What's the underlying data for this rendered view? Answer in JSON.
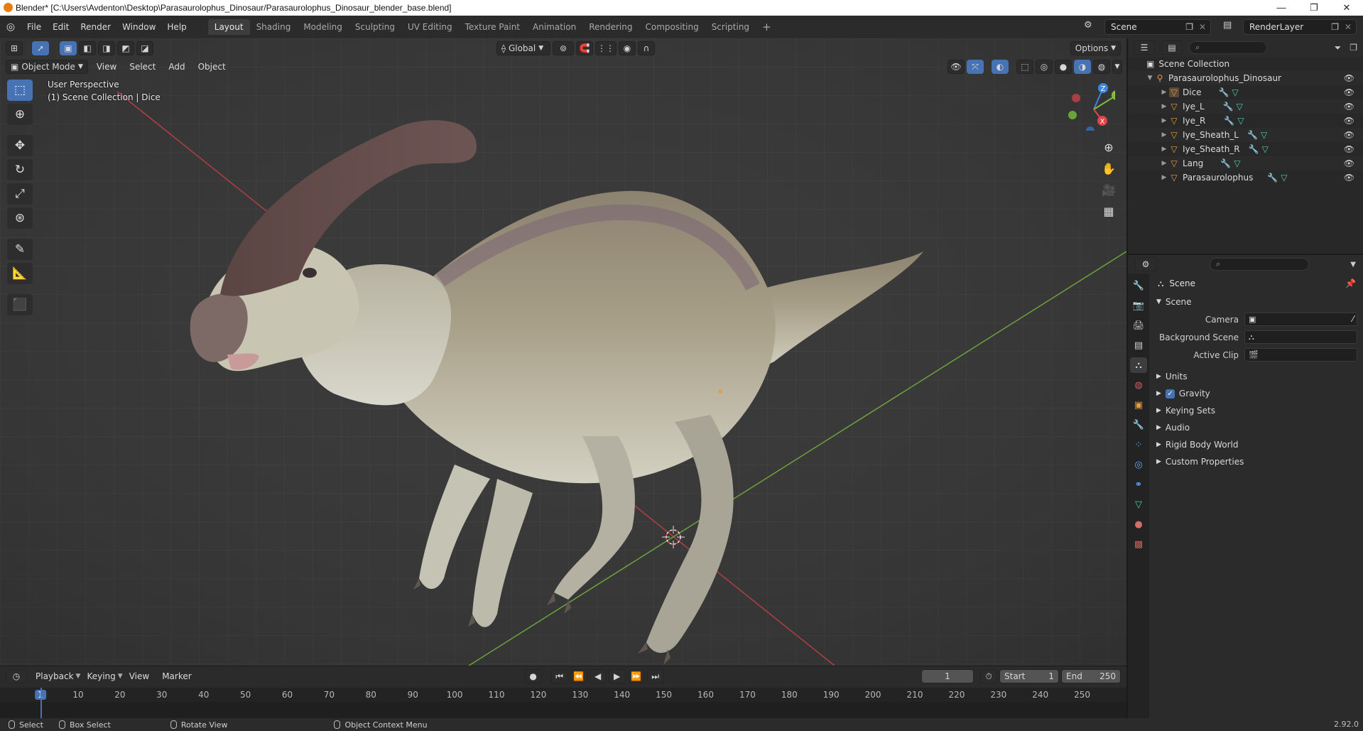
{
  "window": {
    "title": "Blender* [C:\\Users\\Avdenton\\Desktop\\Parasaurolophus_Dinosaur/Parasaurolophus_Dinosaur_blender_base.blend]",
    "controls": [
      "—",
      "❐",
      "✕"
    ]
  },
  "menu": [
    "File",
    "Edit",
    "Render",
    "Window",
    "Help"
  ],
  "workspaces": [
    "Layout",
    "Shading",
    "Modeling",
    "Sculpting",
    "UV Editing",
    "Texture Paint",
    "Animation",
    "Rendering",
    "Compositing",
    "Scripting"
  ],
  "active_workspace": "Layout",
  "scene_selector": "Scene",
  "view_layer": "RenderLayer",
  "viewport": {
    "mode": "Object Mode",
    "menus": [
      "View",
      "Select",
      "Add",
      "Object"
    ],
    "transform_orientation": "Global",
    "options_label": "Options",
    "perspective_label": "User Perspective",
    "collection_label": "(1) Scene Collection | Dice",
    "gizmo_axes": [
      "Z",
      "Y",
      "X"
    ]
  },
  "outliner": {
    "root": "Scene Collection",
    "collection": "Parasaurolophus_Dinosaur",
    "objects": [
      "Dice",
      "Iye_L",
      "Iye_R",
      "Iye_Sheath_L",
      "Iye_Sheath_R",
      "Lang",
      "Parasaurolophus"
    ],
    "search_placeholder": ""
  },
  "properties": {
    "context_title": "Scene",
    "panel_scene": "Scene",
    "fields": [
      {
        "label": "Camera",
        "value": ""
      },
      {
        "label": "Background Scene",
        "value": ""
      },
      {
        "label": "Active Clip",
        "value": ""
      }
    ],
    "panels": [
      "Units",
      "Gravity",
      "Keying Sets",
      "Audio",
      "Rigid Body World",
      "Custom Properties"
    ],
    "gravity_checked": true
  },
  "timeline": {
    "menus": [
      "Playback",
      "Keying",
      "View",
      "Marker"
    ],
    "current_frame": "1",
    "start_label": "Start",
    "start": "1",
    "end_label": "End",
    "end": "250",
    "ticks": [
      "1",
      "10",
      "20",
      "30",
      "40",
      "50",
      "60",
      "70",
      "80",
      "90",
      "100",
      "110",
      "120",
      "130",
      "140",
      "150",
      "160",
      "170",
      "180",
      "190",
      "200",
      "210",
      "220",
      "230",
      "240",
      "250"
    ]
  },
  "statusbar": {
    "select": "Select",
    "box_select": "Box Select",
    "rotate_view": "Rotate View",
    "context_menu": "Object Context Menu",
    "version": "2.92.0"
  },
  "colors": {
    "accent": "#4772b3",
    "x_axis": "#e0424a",
    "y_axis": "#7fbf3a",
    "z_axis": "#3b85e0",
    "object_orange": "#e89b3c"
  }
}
